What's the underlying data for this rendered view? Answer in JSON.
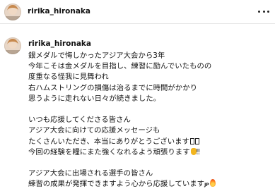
{
  "header": {
    "username": "ririka_hironaka",
    "avatar_icon": "profile-photo",
    "more_icon": "ellipsis-icon"
  },
  "post": {
    "username": "ririka_hironaka",
    "avatar_icon": "profile-photo",
    "caption_lines": [
      "銀メダルで悔しかったアジア大会から3年",
      "今年こそは金メダルを目指し、練習に励んでいたものの",
      "度重なる怪我に見舞われ",
      "右ハムストリングの損傷は治るまでに時間がかかり",
      "思うように走れない日々が続きました。",
      "",
      "いつも応援してくださる皆さん",
      "アジア大会に向けての応援メッセージも",
      "たくさんいただき、本当にありがとうございます",
      "今回の経験を糧にまた強くなれるよう頑張ります",
      "",
      "アジア大会に出場される選手の皆さん",
      "練習の成果が発揮できますよう心から応援しています"
    ],
    "emoji_line9": "tofu-glyphs",
    "emoji_line10_suffix": "‼",
    "emoji_line13_prefix": "JP"
  }
}
